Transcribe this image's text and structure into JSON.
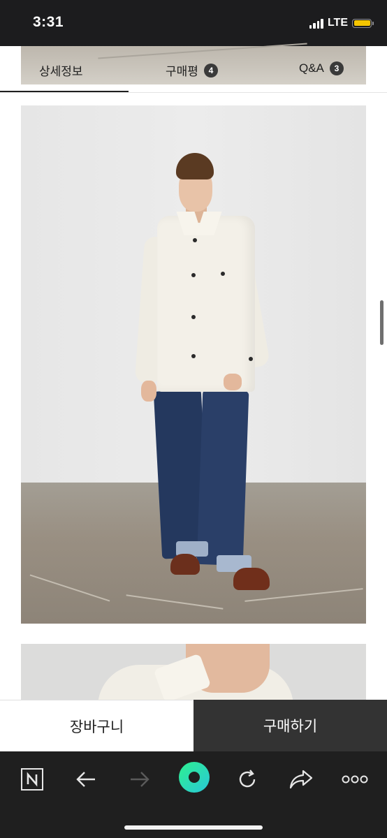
{
  "status_bar": {
    "time": "3:31",
    "network": "LTE",
    "battery_color": "#f5c500",
    "icons": [
      "signal-icon",
      "battery-icon"
    ]
  },
  "tabs": [
    {
      "label": "상세정보",
      "count": null,
      "active": true
    },
    {
      "label": "구매평",
      "count": "4",
      "active": false
    },
    {
      "label": "Q&A",
      "count": "3",
      "active": false
    }
  ],
  "content": {
    "images": [
      "product-photo-full-body",
      "product-photo-collar-detail"
    ]
  },
  "actions": {
    "cart_label": "장바구니",
    "buy_label": "구매하기",
    "buy_bg_color": "#333333"
  },
  "browser_toolbar": {
    "icons": [
      "naver-home-icon",
      "back-arrow-icon",
      "forward-arrow-icon",
      "green-dot-icon",
      "reload-icon",
      "share-icon",
      "more-icon"
    ],
    "accent_color": "#2ee5a0"
  }
}
